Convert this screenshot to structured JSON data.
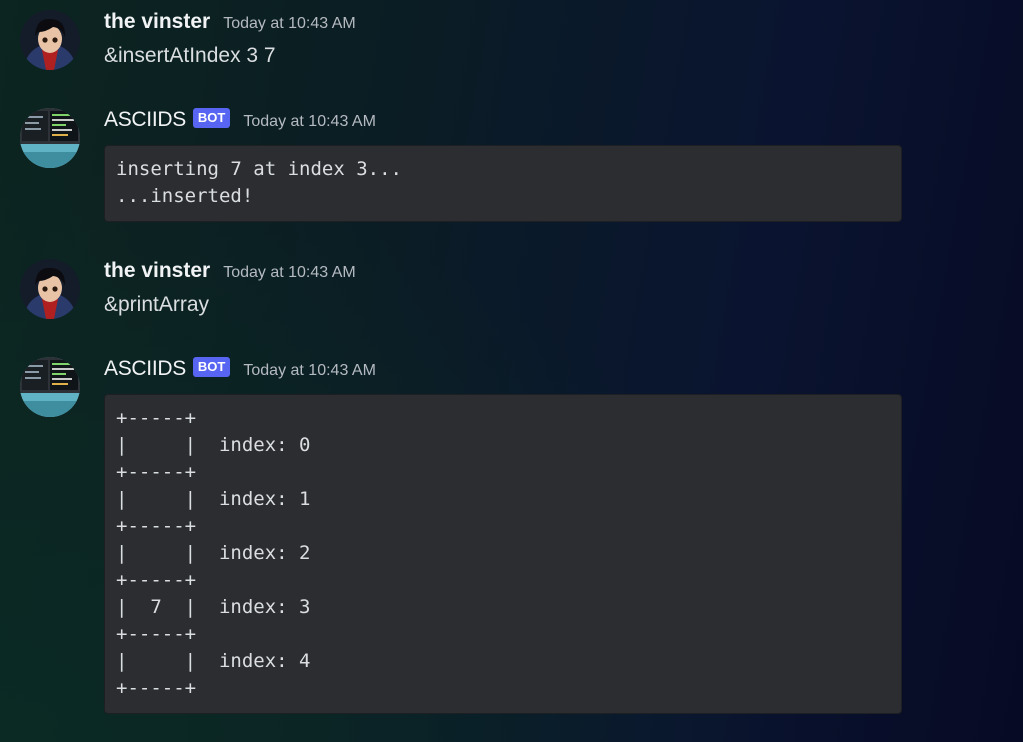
{
  "messages": [
    {
      "author": "the vinster",
      "timestamp": "Today at 10:43 AM",
      "text": "&insertAtIndex 3 7"
    },
    {
      "author": "ASCIIDS",
      "bot_tag": "BOT",
      "timestamp": "Today at 10:43 AM",
      "code": "inserting 7 at index 3...\n...inserted!"
    },
    {
      "author": "the vinster",
      "timestamp": "Today at 10:43 AM",
      "text": "&printArray"
    },
    {
      "author": "ASCIIDS",
      "bot_tag": "BOT",
      "timestamp": "Today at 10:43 AM",
      "code": "+-----+\n|     |  index: 0\n+-----+\n|     |  index: 1\n+-----+\n|     |  index: 2\n+-----+\n|  7  |  index: 3\n+-----+\n|     |  index: 4\n+-----+"
    }
  ],
  "colors": {
    "bot_tag": "#5865f2",
    "codeblock_bg": "#2b2d31",
    "timestamp": "#b5bac1"
  }
}
